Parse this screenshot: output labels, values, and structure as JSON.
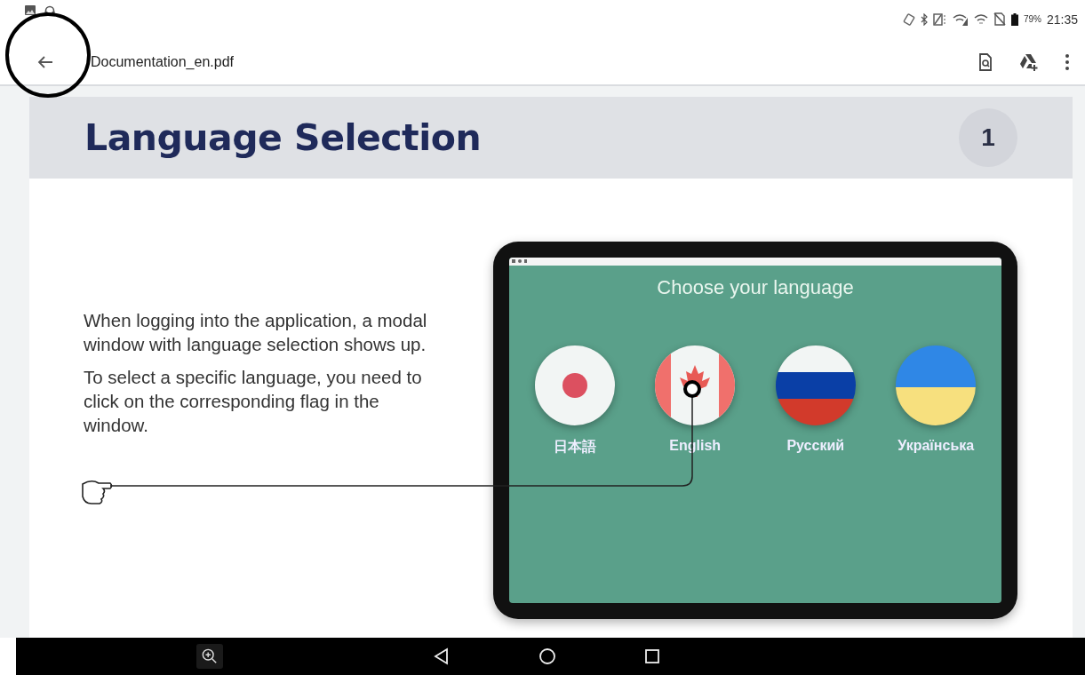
{
  "status_bar": {
    "battery_percent": "79%",
    "time": "21:35"
  },
  "app_bar": {
    "title": "Documentation_en.pdf"
  },
  "page": {
    "heading": "Language Selection",
    "page_number": "1",
    "paragraphs": [
      "When logging into the application, a modal window with language selection shows up.",
      "To select a specific language, you need to click on the corresponding flag in the window."
    ],
    "tablet": {
      "title": "Choose your language",
      "languages": [
        {
          "label": "日本語",
          "kind": "japan"
        },
        {
          "label": "English",
          "kind": "canada"
        },
        {
          "label": "Русский",
          "kind": "russia"
        },
        {
          "label": "Українська",
          "kind": "ukraine"
        }
      ]
    }
  }
}
